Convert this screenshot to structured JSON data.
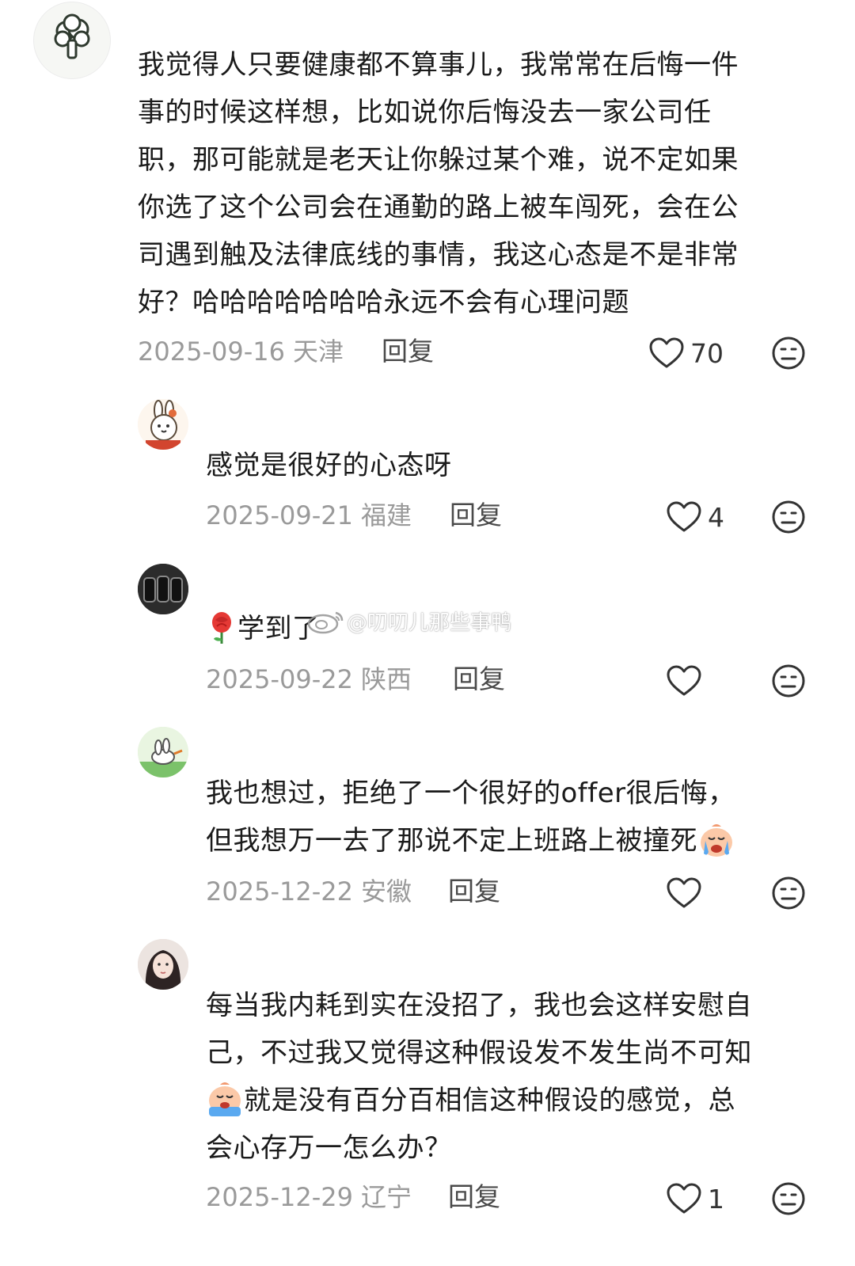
{
  "comments": [
    {
      "lines": [
        "我觉得人只要健康都不算事儿，我常常在后悔一件",
        "事的时候这样想，比如说你后悔没去一家公司任",
        "职，那可能就是老天让你躲过某个难，说不定如果",
        "你选了这个公司会在通勤的路上被车闯死，会在公",
        "司遇到触及法律底线的事情，我这心态是不是非常",
        "好？哈哈哈哈哈哈哈永远不会有心理问题"
      ],
      "date": "2025-09-16",
      "region": "天津",
      "reply": "回复",
      "likes": "70",
      "avatar": "broccoli-avatar"
    },
    {
      "lines": [
        "感觉是很好的心态呀"
      ],
      "date": "2025-09-21",
      "region": "福建",
      "reply": "回复",
      "likes": "4",
      "avatar": "cartoon-bunny-avatar"
    },
    {
      "lines": [
        "学到了"
      ],
      "emoji": "rose-emoji",
      "date": "2025-09-22",
      "region": "陕西",
      "reply": "回复",
      "likes": "",
      "avatar": "dark-photo-avatar"
    },
    {
      "lines": [
        "我也想过，拒绝了一个很好的offer很后悔，",
        "但我想万一去了那说不定上班路上被撞死"
      ],
      "emoji": "crying-face-emoji",
      "date": "2025-12-22",
      "region": "安徽",
      "reply": "回复",
      "likes": "",
      "avatar": "green-bunny-avatar"
    },
    {
      "lines": [
        "每当我内耗到实在没招了，我也会这样安慰自",
        "己，不过我又觉得这种假设发不发生尚不可知",
        "就是没有百分百相信这种假设的感觉，总",
        "会心存万一怎么办？"
      ],
      "emoji": "crying-face-emoji",
      "date": "2025-12-29",
      "region": "辽宁",
      "reply": "回复",
      "likes": "1",
      "avatar": "girl-photo-avatar"
    }
  ],
  "watermark": "@叨叨儿那些事鸭",
  "icons": {
    "like": "heart-outline-icon",
    "dislike": "neutral-face-icon"
  },
  "colors": {
    "meta_text": "#9a9a9a",
    "body_text": "#1b1b1b",
    "icon_stroke": "#333333"
  }
}
